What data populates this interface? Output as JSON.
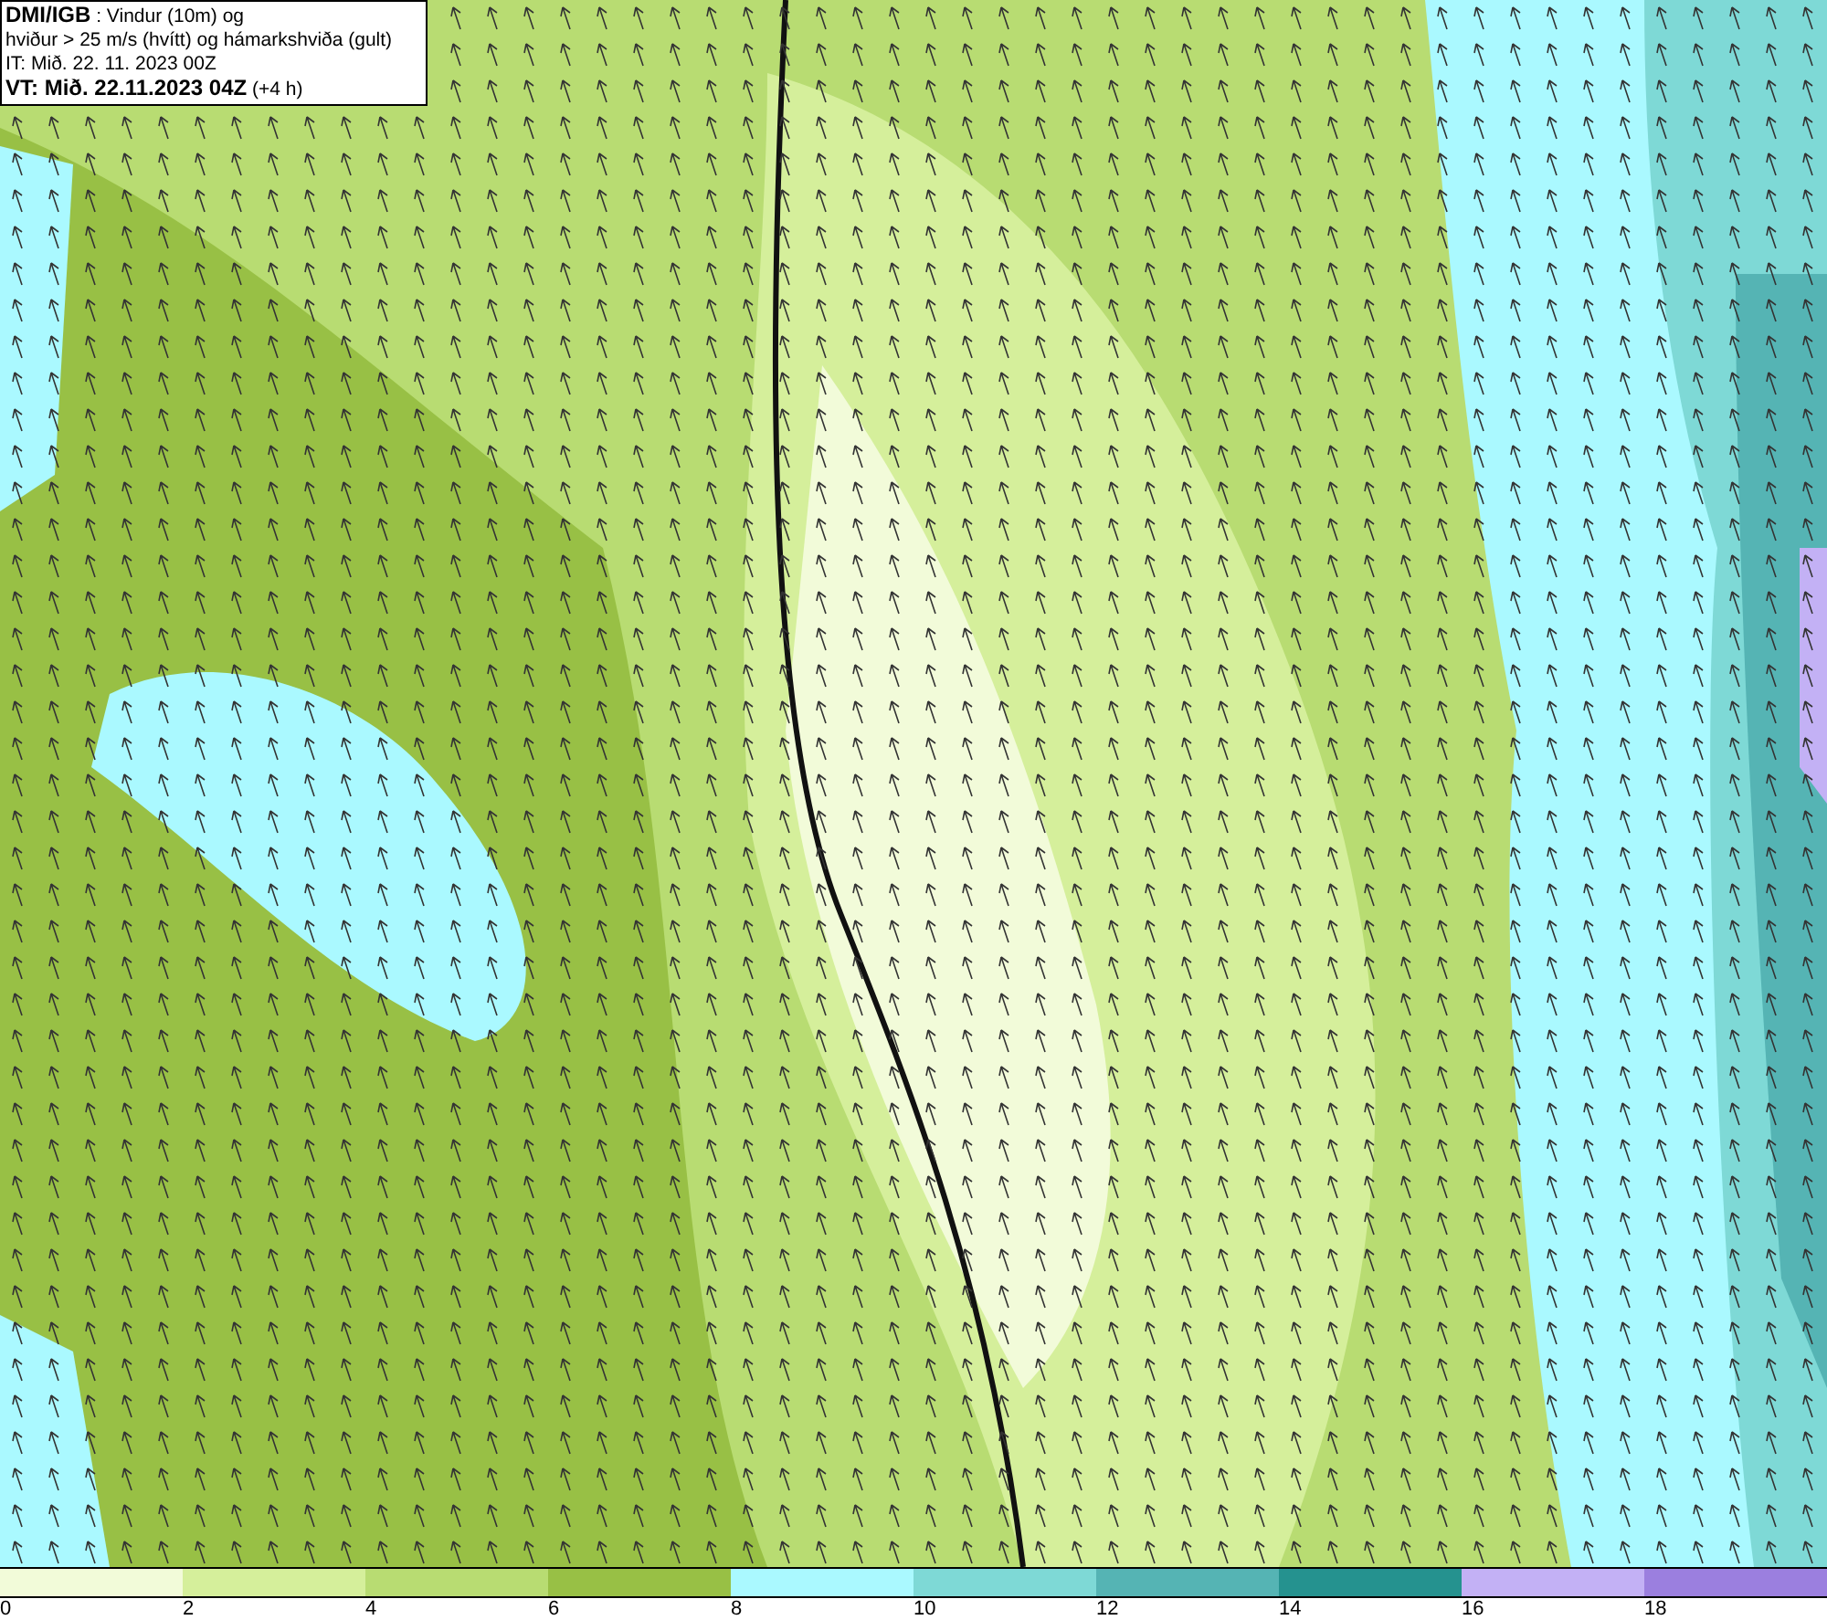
{
  "info_box": {
    "lines": [
      "**DMI/IGB** : Vindur (10m) og",
      "hviður > 25 m/s (hvítt) og hámarkshviða (gult)",
      "IT: Mið. 22. 11. 2023 00Z",
      "**VT: Mið. 22.11.2023 04Z** (+4 h)"
    ]
  },
  "legend": {
    "segments": [
      {
        "color": "#f2fbd9"
      },
      {
        "color": "#d5ef9b"
      },
      {
        "color": "#b8dc72"
      },
      {
        "color": "#98c045"
      },
      {
        "color": "#aaf9ff"
      },
      {
        "color": "#7ed9d6"
      },
      {
        "color": "#55b4b4"
      },
      {
        "color": "#25928f"
      },
      {
        "color": "#c3b1f5"
      },
      {
        "color": "#9b7fdf"
      }
    ],
    "ticks": [
      "0",
      "2",
      "4",
      "6",
      "8",
      "10",
      "12",
      "14",
      "16",
      "18"
    ]
  }
}
